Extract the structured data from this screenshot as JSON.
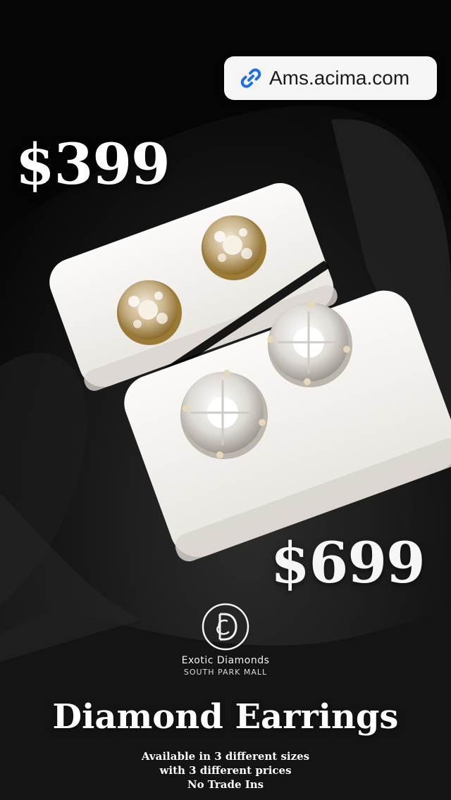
{
  "link": {
    "text": "Ams.acima.com",
    "icon": "link-icon"
  },
  "prices": {
    "small": "$399",
    "large": "$699"
  },
  "brand": {
    "name": "Exotic Diamonds",
    "location": "SOUTH PARK MALL",
    "monogram": "ED"
  },
  "headline": "Diamond Earrings",
  "details": [
    "Available in 3 different sizes",
    "with 3 different prices",
    "No Trade Ins"
  ],
  "colors": {
    "background": "#0b0b0b",
    "cushion": "#f4f2ee",
    "gold": "#c9a24a",
    "white_gold": "#e6e6e6"
  }
}
